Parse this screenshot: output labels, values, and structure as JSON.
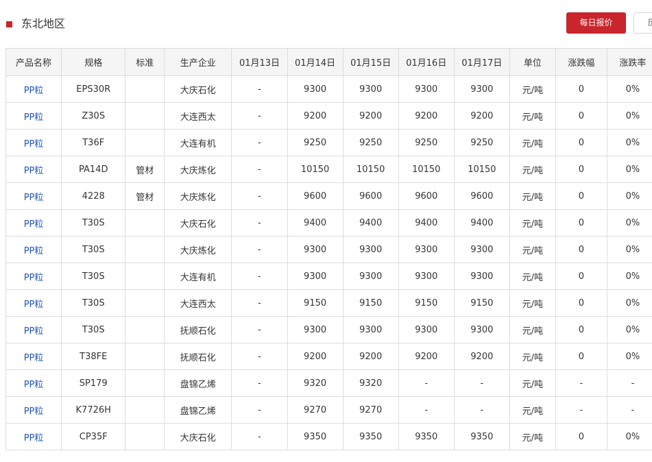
{
  "header": {
    "title": "东北地区",
    "daily_quote_button": "每日报价",
    "second_button": "历史价格"
  },
  "table": {
    "columns": [
      "产品名称",
      "规格",
      "标准",
      "生产企业",
      "01月13日",
      "01月14日",
      "01月15日",
      "01月16日",
      "01月17日",
      "单位",
      "涨跌幅",
      "涨跌率"
    ],
    "rows": [
      [
        "PP粒",
        "EPS30R",
        "",
        "大庆石化",
        "-",
        "9300",
        "9300",
        "9300",
        "9300",
        "元/吨",
        "0",
        "0%"
      ],
      [
        "PP粒",
        "Z30S",
        "",
        "大连西太",
        "-",
        "9200",
        "9200",
        "9200",
        "9200",
        "元/吨",
        "0",
        "0%"
      ],
      [
        "PP粒",
        "T36F",
        "",
        "大连有机",
        "-",
        "9250",
        "9250",
        "9250",
        "9250",
        "元/吨",
        "0",
        "0%"
      ],
      [
        "PP粒",
        "PA14D",
        "管材",
        "大庆炼化",
        "-",
        "10150",
        "10150",
        "10150",
        "10150",
        "元/吨",
        "0",
        "0%"
      ],
      [
        "PP粒",
        "4228",
        "管材",
        "大庆炼化",
        "-",
        "9600",
        "9600",
        "9600",
        "9600",
        "元/吨",
        "0",
        "0%"
      ],
      [
        "PP粒",
        "T30S",
        "",
        "大庆石化",
        "-",
        "9400",
        "9400",
        "9400",
        "9400",
        "元/吨",
        "0",
        "0%"
      ],
      [
        "PP粒",
        "T30S",
        "",
        "大庆炼化",
        "-",
        "9300",
        "9300",
        "9300",
        "9300",
        "元/吨",
        "0",
        "0%"
      ],
      [
        "PP粒",
        "T30S",
        "",
        "大连有机",
        "-",
        "9300",
        "9300",
        "9300",
        "9300",
        "元/吨",
        "0",
        "0%"
      ],
      [
        "PP粒",
        "T30S",
        "",
        "大连西太",
        "-",
        "9150",
        "9150",
        "9150",
        "9150",
        "元/吨",
        "0",
        "0%"
      ],
      [
        "PP粒",
        "T30S",
        "",
        "抚顺石化",
        "-",
        "9300",
        "9300",
        "9300",
        "9300",
        "元/吨",
        "0",
        "0%"
      ],
      [
        "PP粒",
        "T38FE",
        "",
        "抚顺石化",
        "-",
        "9200",
        "9200",
        "9200",
        "9200",
        "元/吨",
        "0",
        "0%"
      ],
      [
        "PP粒",
        "SP179",
        "",
        "盘锦乙烯",
        "-",
        "9320",
        "9320",
        "-",
        "-",
        "元/吨",
        "-",
        "-"
      ],
      [
        "PP粒",
        "K7726H",
        "",
        "盘锦乙烯",
        "-",
        "9270",
        "9270",
        "-",
        "-",
        "元/吨",
        "-",
        "-"
      ],
      [
        "PP粒",
        "CP35F",
        "",
        "大庆石化",
        "-",
        "9350",
        "9350",
        "9350",
        "9350",
        "元/吨",
        "0",
        "0%"
      ]
    ]
  },
  "colors": {
    "accent": "#c9252c",
    "link": "#2255bb",
    "header_bg": "#f5f5f5",
    "border": "#dcdcdc"
  }
}
